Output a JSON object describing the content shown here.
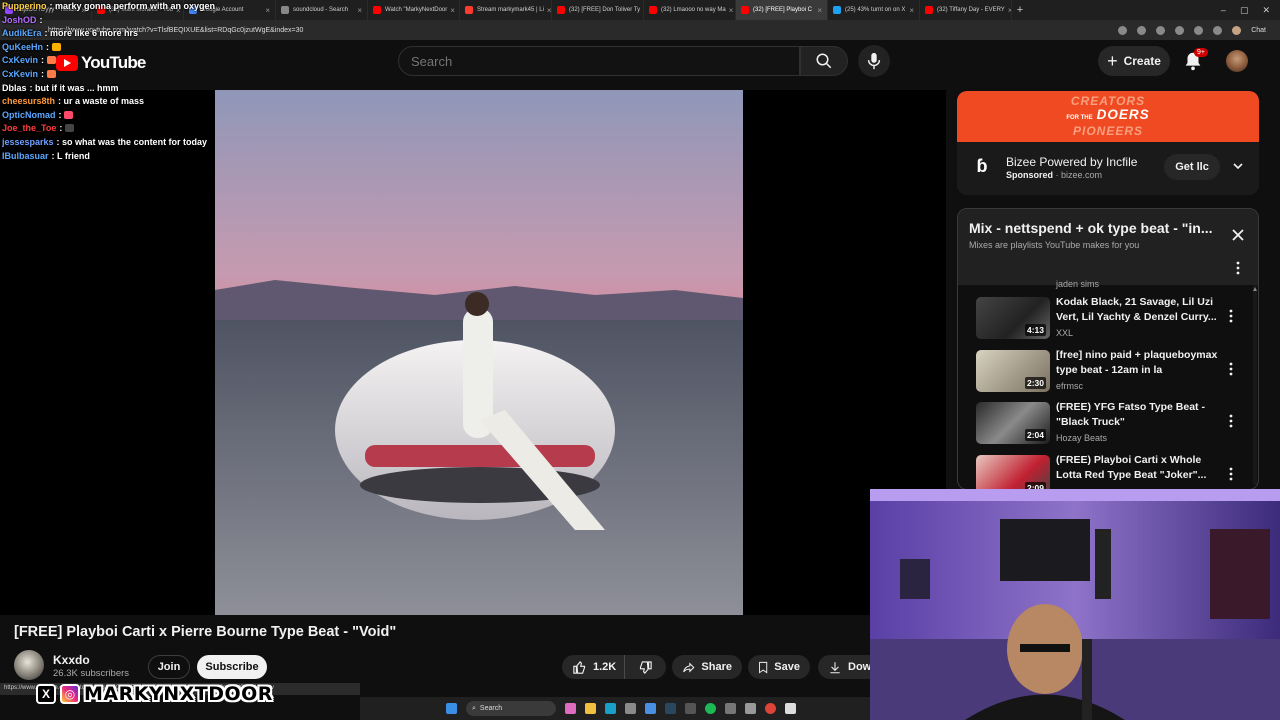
{
  "browser": {
    "tabs": [
      {
        "label": "bajaOUTDyyy - Twitch",
        "color": "#9146ff"
      },
      {
        "label": "(32) Mark Morales - You",
        "color": "#ff0000"
      },
      {
        "label": "Google Account",
        "color": "#4285f4"
      },
      {
        "label": "soundcloud - Search",
        "color": "#888888"
      },
      {
        "label": "Watch \"MarkyNextDoor",
        "color": "#ff0000"
      },
      {
        "label": "Stream markymark45 | Li",
        "color": "#ff3b30"
      },
      {
        "label": "(32) [FREE] Don Toliver Ty",
        "color": "#ff0000"
      },
      {
        "label": "(32) Lmaooo no way Ma",
        "color": "#ff0000"
      },
      {
        "label": "(32) [FREE] Playboi C",
        "color": "#ff0000",
        "active": true
      },
      {
        "label": "(25) 43% turnt on on X",
        "color": "#1da1f2"
      },
      {
        "label": "(32) Tiffany Day - EVERY",
        "color": "#ff0000"
      }
    ],
    "url": "https://www.youtube.com/watch?v=TlsfBEQIXUE&list=RDqGc0jzutWgE&index=30",
    "chat_label": "Chat",
    "status_url": "https://www.youtube.com/watch?v=TlsfBEQIXUE&list=RDqGc0jzutWgE&index=30gcJCdQKAYcqlYzv"
  },
  "masthead": {
    "logo_text": "YouTube",
    "search_placeholder": "Search",
    "create_label": "Create",
    "notif_count": "9+"
  },
  "chat": [
    {
      "user": "Pupperino",
      "color": "#ffd24a",
      "msg": "marky gonna perform with an oxygen tank like dave blunts lol",
      "emote": ""
    },
    {
      "user": "JoshOD",
      "color": "#b36cff",
      "msg": "",
      "emote": ""
    },
    {
      "user": "AudikEra",
      "color": "#5aa7ff",
      "msg": "more like 6 more hrs",
      "emote": ""
    },
    {
      "user": "QuKeeHn",
      "color": "#5aa7ff",
      "msg": "",
      "emote": "#ffb000"
    },
    {
      "user": "CxKevin",
      "color": "#5aa7ff",
      "msg": "",
      "emote": "#ff7b4a"
    },
    {
      "user": "CxKevin",
      "color": "#5aa7ff",
      "msg": "",
      "emote": "#ff7b4a"
    },
    {
      "user": "Dblas",
      "color": "#ffffff",
      "msg": "but if it was ... hmm",
      "emote": ""
    },
    {
      "user": "cheesurs8th",
      "color": "#ff9a3c",
      "msg": "ur a waste of mass",
      "emote": ""
    },
    {
      "user": "OpticNomad",
      "color": "#5aa7ff",
      "msg": "",
      "emote": "#ff4a6a"
    },
    {
      "user": "Joe_the_Toe",
      "color": "#ff3b3b",
      "msg": "",
      "emote": "#444444"
    },
    {
      "user": "jessesparks",
      "color": "#6fa0ff",
      "msg": "so what was the content for today",
      "emote": ""
    },
    {
      "user": "IBulbasuar",
      "color": "#5aa7ff",
      "msg": "L friend",
      "emote": ""
    }
  ],
  "video": {
    "title": "[FREE] Playboi Carti x Pierre Bourne Type Beat - \"Void\"",
    "channel": "Kxxdo",
    "subscribers": "26.3K subscribers",
    "join_label": "Join",
    "subscribe_label": "Subscribe",
    "likes": "1.2K",
    "share_label": "Share",
    "save_label": "Save",
    "download_label": "Down"
  },
  "ad": {
    "banner_lines": [
      "CREATORS",
      "DOERS",
      "PIONEERS"
    ],
    "banner_prefix": "FOR THE",
    "title": "Bizee Powered by Incfile",
    "sponsored": "Sponsored",
    "domain": "bizee.com",
    "cta": "Get llc"
  },
  "mix": {
    "title": "Mix - nettspend + ok type beat - \"in...",
    "subtitle": "Mixes are playlists YouTube makes for you",
    "cut_channel": "jaden sims",
    "items": [
      {
        "title": "Kodak Black, 21 Savage, Lil Uzi Vert, Lil Yachty & Denzel Curry...",
        "channel": "XXL",
        "duration": "4:13"
      },
      {
        "title": "[free] nino paid + plaqueboymax type beat - 12am in la",
        "channel": "efrmsc",
        "duration": "2:30"
      },
      {
        "title": "(FREE) YFG Fatso Type Beat - \"Black Truck\"",
        "channel": "Hozay Beats",
        "duration": "2:04"
      },
      {
        "title": "(FREE) Playboi Carti x Whole Lotta Red Type Beat \"Joker\"...",
        "channel": "",
        "duration": "2:09"
      }
    ]
  },
  "overlay": {
    "handle": "MARKYNXTDOOR"
  },
  "taskbar": {
    "search_label": "Search"
  },
  "colors": {
    "yt_red": "#ff0000",
    "ad_orange": "#f04a23",
    "bg": "#0f0f0f"
  }
}
